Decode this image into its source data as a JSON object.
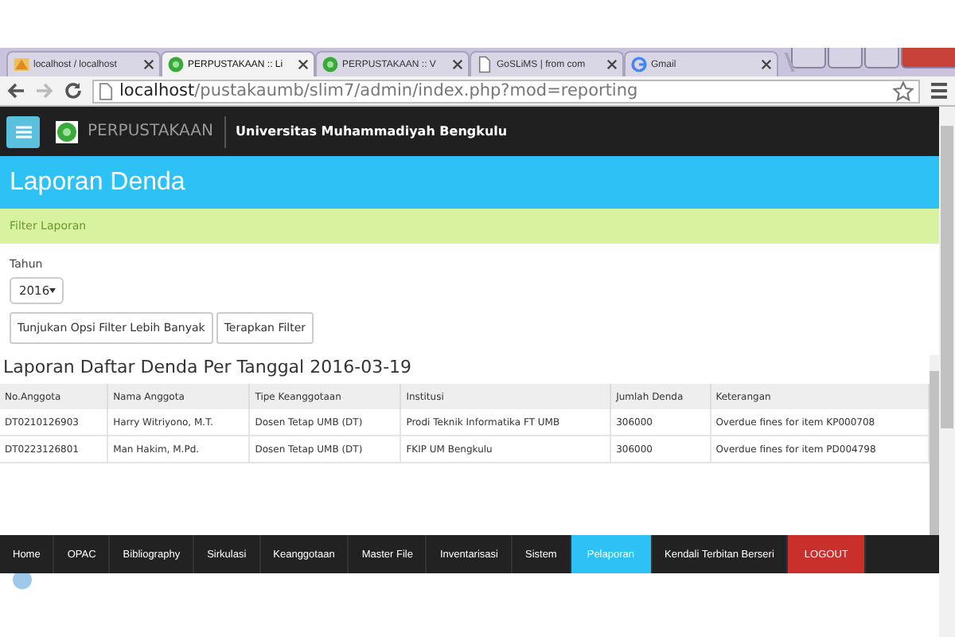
{
  "browser": {
    "tabs": [
      {
        "label": "localhost / localhost",
        "selected": false
      },
      {
        "label": "PERPUSTAKAAN :: Li",
        "selected": true
      },
      {
        "label": "PERPUSTAKAAN :: V",
        "selected": false
      },
      {
        "label": "GoSLiMS | from com",
        "selected": false
      },
      {
        "label": "Gmail",
        "selected": false
      }
    ],
    "url_host": "localhost",
    "url_path": "/pustakaumb/slim7/admin/index.php?mod=reporting"
  },
  "header": {
    "app_name": "PERPUSTAKAAN",
    "institution": "Universitas Muhammadiyah Bengkulu"
  },
  "page_title": "Laporan Denda",
  "filter_bar": "Filter Laporan",
  "filter": {
    "year_label": "Tahun",
    "year_value": "2016",
    "buttons": [
      "Tunjukan Opsi Filter Lebih Banyak",
      "Terapkan Filter"
    ]
  },
  "report": {
    "title": "Laporan Daftar Denda Per Tanggal 2016-03-19",
    "columns": [
      "No.Anggota",
      "Nama Anggota",
      "Tipe Keanggotaan",
      "Institusi",
      "Jumlah Denda",
      "Keterangan"
    ],
    "rows": [
      [
        "DT0210126903",
        "Harry Witriyono, M.T.",
        "Dosen Tetap UMB (DT)",
        "Prodi Teknik Informatika FT UMB",
        "306000",
        "Overdue fines for item KP000708"
      ],
      [
        "DT0223126801",
        "Man Hakim, M.Pd.",
        "Dosen Tetap UMB (DT)",
        "FKIP UM Bengkulu",
        "306000",
        "Overdue fines for item PD004798"
      ]
    ]
  },
  "nav": [
    {
      "label": "Home",
      "selected": false,
      "kind": "link"
    },
    {
      "label": "OPAC",
      "selected": false,
      "kind": "link"
    },
    {
      "label": "Bibliography",
      "selected": false,
      "kind": "link"
    },
    {
      "label": "Sirkulasi",
      "selected": false,
      "kind": "link"
    },
    {
      "label": "Keanggotaan",
      "selected": false,
      "kind": "link"
    },
    {
      "label": "Master File",
      "selected": false,
      "kind": "link"
    },
    {
      "label": "Inventarisasi",
      "selected": false,
      "kind": "link"
    },
    {
      "label": "Sistem",
      "selected": false,
      "kind": "link"
    },
    {
      "label": "Pelaporan",
      "selected": true,
      "kind": "link"
    },
    {
      "label": "Kendali Terbitan Berseri",
      "selected": false,
      "kind": "link"
    },
    {
      "label": "LOGOUT",
      "selected": false,
      "kind": "logout"
    }
  ]
}
